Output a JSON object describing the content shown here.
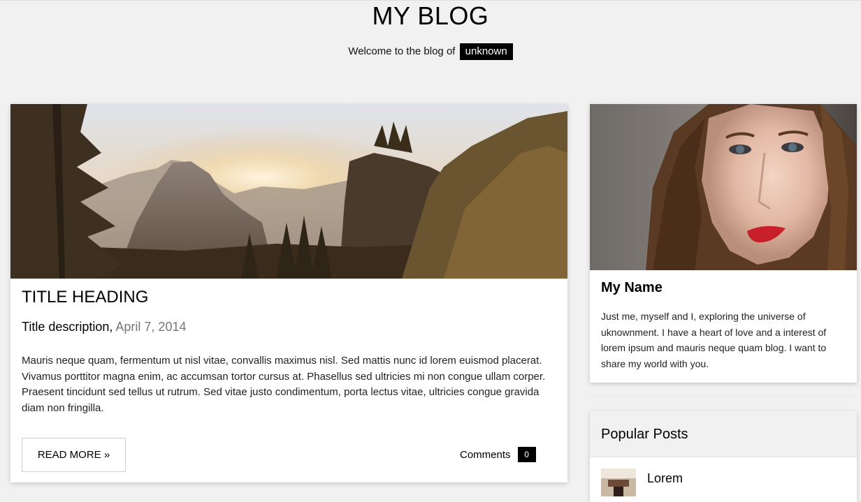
{
  "header": {
    "title": "MY BLOG",
    "welcome_text": "Welcome to the blog of",
    "welcome_name": "unknown"
  },
  "post": {
    "title": "TITLE HEADING",
    "description": "Title description,",
    "date": "April 7, 2014",
    "body": "Mauris neque quam, fermentum ut nisl vitae, convallis maximus nisl. Sed mattis nunc id lorem euismod placerat. Vivamus porttitor magna enim, ac accumsan tortor cursus at. Phasellus sed ultricies mi non congue ullam corper. Praesent tincidunt sed tellus ut rutrum. Sed vitae justo condimentum, porta lectus vitae, ultricies congue gravida diam non fringilla.",
    "read_more_label": "READ MORE »",
    "comments_label": "Comments",
    "comments_count": "0",
    "image": "mountain-landscape-image"
  },
  "profile": {
    "name": "My Name",
    "bio": "Just me, myself and I, exploring the universe of uknownment. I have a heart of love and a interest of lorem ipsum and mauris neque quam blog. I want to share my world with you.",
    "image": "woman-portrait-image"
  },
  "popular": {
    "title": "Popular Posts",
    "items": [
      {
        "label": "Lorem",
        "image": "post-thumbnail-image"
      }
    ]
  },
  "colors": {
    "background": "#f1f1f1",
    "card": "#ffffff",
    "badge": "#000000",
    "muted_text": "#777777"
  }
}
